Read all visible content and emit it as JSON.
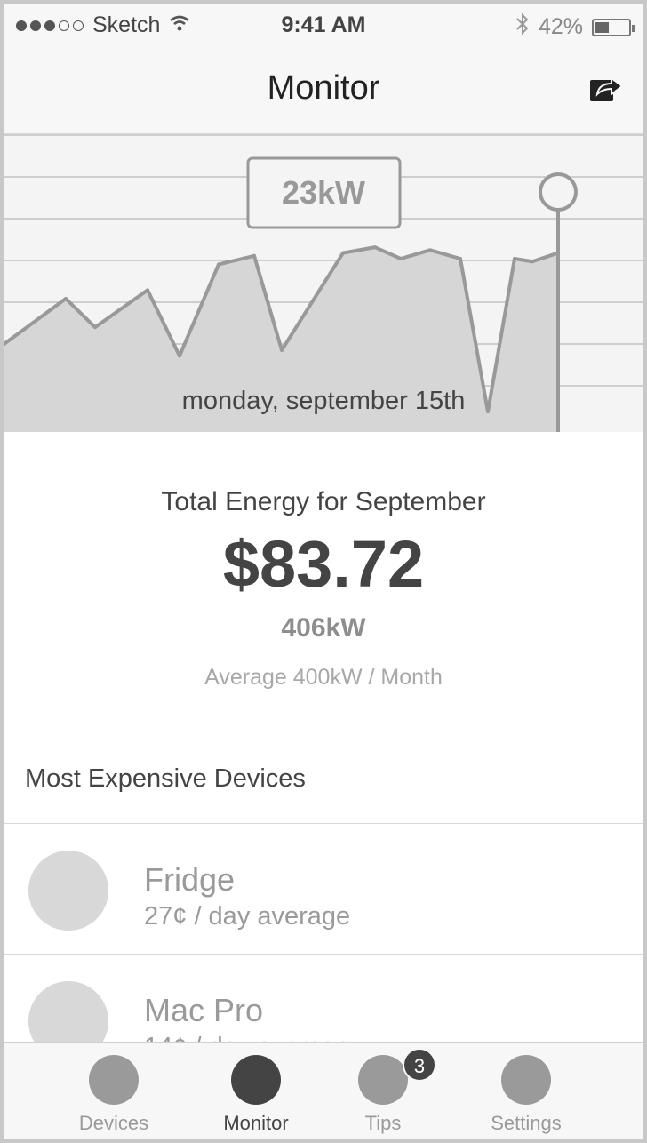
{
  "status_bar": {
    "carrier": "Sketch",
    "time": "9:41 AM",
    "battery_percent": "42%",
    "battery_level": 0.42,
    "signal_bars": 3,
    "signal_total": 5,
    "icons": [
      "wifi-icon",
      "bluetooth-icon",
      "battery-icon"
    ]
  },
  "nav": {
    "title": "Monitor",
    "share_icon": "share-icon"
  },
  "chart": {
    "tooltip_value": "23kW",
    "date_label": "monday, september 15th",
    "fill_color": "#d6d6d6",
    "line_color": "#999999"
  },
  "chart_data": {
    "type": "area",
    "series": [
      {
        "values": [
          12,
          28,
          18,
          31,
          8,
          40,
          43,
          10,
          44,
          46,
          42,
          45,
          42,
          0,
          42,
          41,
          44
        ]
      }
    ],
    "ylim": [
      0,
      70
    ],
    "grid": true,
    "highlight_index": 16,
    "highlight_label": "23kW"
  },
  "summary": {
    "title": "Total Energy for September",
    "cost": "$83.72",
    "energy": "406kW",
    "average": "Average 400kW / Month"
  },
  "devices": {
    "section_title": "Most Expensive Devices",
    "items": [
      {
        "name": "Fridge",
        "cost": "27¢ / day average"
      },
      {
        "name": "Mac Pro",
        "cost": "14¢ / day average"
      }
    ]
  },
  "tabs": [
    {
      "label": "Devices",
      "active": false
    },
    {
      "label": "Monitor",
      "active": true
    },
    {
      "label": "Tips",
      "active": false,
      "badge": "3"
    },
    {
      "label": "Settings",
      "active": false
    }
  ]
}
